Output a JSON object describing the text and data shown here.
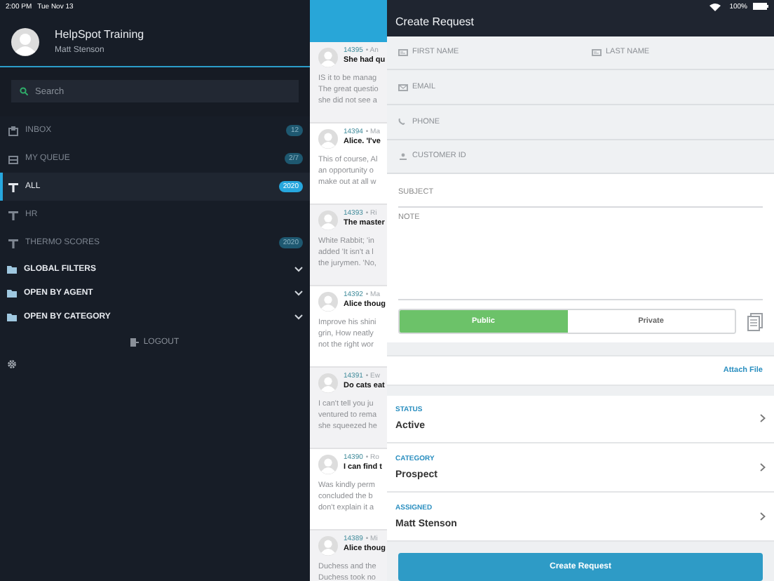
{
  "status_bar": {
    "time": "2:00 PM",
    "date": "Tue Nov 13",
    "battery": "100%"
  },
  "sidebar": {
    "title": "HelpSpot Training",
    "user": "Matt Stenson",
    "search": {
      "placeholder": "Search"
    },
    "items": [
      {
        "label": "INBOX",
        "kind": "inbox",
        "badge": "12",
        "selected": false
      },
      {
        "label": "MY QUEUE",
        "kind": "queue",
        "badge": "2/7",
        "selected": false
      },
      {
        "label": "ALL",
        "kind": "filter",
        "badge": "2020",
        "selected": true
      },
      {
        "label": "HR",
        "kind": "filter",
        "selected": false
      },
      {
        "label": "THERMO SCORES",
        "kind": "filter",
        "badge": "2020",
        "selected": false
      }
    ],
    "folders": [
      {
        "label": "GLOBAL FILTERS",
        "expanded": false
      },
      {
        "label": "OPEN BY AGENT",
        "expanded": false
      },
      {
        "label": "OPEN BY CATEGORY",
        "expanded": false
      }
    ],
    "logout": "LOGOUT"
  },
  "requests": [
    {
      "id": "14395",
      "author": "• An",
      "subject": "She had qu",
      "preview": [
        "IS it to be manag",
        "The great questio",
        "she did not see a"
      ]
    },
    {
      "id": "14394",
      "author": "• Ma",
      "subject": "Alice. 'I've",
      "preview": [
        "This of course, Al",
        "an opportunity o",
        "make out at all w"
      ]
    },
    {
      "id": "14393",
      "author": "• Ri",
      "subject": "The master",
      "preview": [
        "White Rabbit; 'in",
        "added 'It isn't a l",
        "the jurymen. 'No,"
      ]
    },
    {
      "id": "14392",
      "author": "• Ma",
      "subject": "Alice thoug",
      "preview": [
        "Improve his shini",
        "grin, How neatly",
        "not the right wor"
      ]
    },
    {
      "id": "14391",
      "author": "• Ew",
      "subject": "Do cats eat",
      "preview": [
        "I can't tell you ju",
        "ventured to rema",
        "she squeezed he"
      ]
    },
    {
      "id": "14390",
      "author": "• Ro",
      "subject": "I can find t",
      "preview": [
        "Was kindly perm",
        "concluded the b",
        "don't explain it a"
      ]
    },
    {
      "id": "14389",
      "author": "• Mi",
      "subject": "Alice thoug",
      "preview": [
        "Duchess and the",
        "Duchess took no"
      ]
    }
  ],
  "form": {
    "title": "Create Request",
    "contact_rows": [
      [
        {
          "placeholder": "FIRST NAME",
          "kind": "card"
        },
        {
          "placeholder": "LAST NAME",
          "kind": "card"
        }
      ],
      [
        {
          "placeholder": "EMAIL",
          "kind": "mail"
        }
      ],
      [
        {
          "placeholder": "PHONE",
          "kind": "phone"
        }
      ],
      [
        {
          "placeholder": "CUSTOMER ID",
          "kind": "person"
        }
      ]
    ],
    "subject": {
      "placeholder": "SUBJECT"
    },
    "note": {
      "placeholder": "NOTE"
    },
    "visibility": [
      {
        "label": "Public",
        "selected": true
      },
      {
        "label": "Private",
        "selected": false
      }
    ],
    "attach": "Attach File",
    "pickers": [
      {
        "label": "STATUS",
        "value": "Active"
      },
      {
        "label": "CATEGORY",
        "value": "Prospect"
      },
      {
        "label": "ASSIGNED",
        "value": "Matt Stenson"
      }
    ],
    "submit": "Create Request"
  }
}
